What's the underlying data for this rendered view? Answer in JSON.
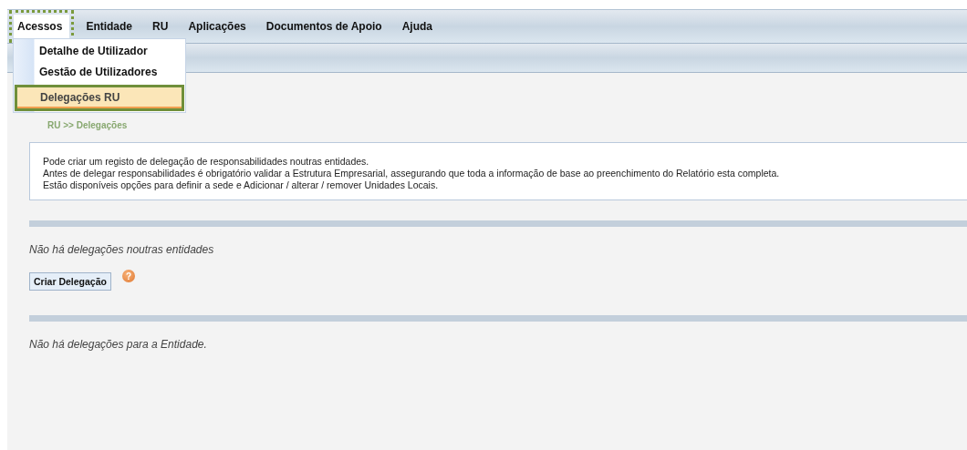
{
  "menu_bar": {
    "items": [
      {
        "label": "Acessos",
        "selected": true
      },
      {
        "label": "Entidade",
        "selected": false
      },
      {
        "label": "RU",
        "selected": false
      },
      {
        "label": "Aplicações",
        "selected": false
      },
      {
        "label": "Documentos de Apoio",
        "selected": false
      },
      {
        "label": "Ajuda",
        "selected": false
      }
    ]
  },
  "dropdown": {
    "items": [
      {
        "label": "Detalhe de Utilizador",
        "selected": false
      },
      {
        "label": "Gestão de Utilizadores",
        "selected": false
      },
      {
        "label": "Delegações RU",
        "selected": true
      }
    ]
  },
  "breadcrumb": "RU >> Delegações",
  "info_box": {
    "lines": [
      "Pode criar um registo de delegação de responsabilidades noutras entidades.",
      "Antes de delegar responsabilidades é obrigatório validar a Estrutura Empresarial, assegurando que toda a informação de base ao preenchimento do Relatório esta completa.",
      "Estão disponíveis opções para definir a sede e Adicionar / alterar / remover Unidades Locais."
    ]
  },
  "section_1": {
    "message": "Não há delegações noutras entidades",
    "button": "Criar Delegação",
    "help_icon": "?"
  },
  "section_2": {
    "message": "Não há delegações para a Entidade."
  }
}
